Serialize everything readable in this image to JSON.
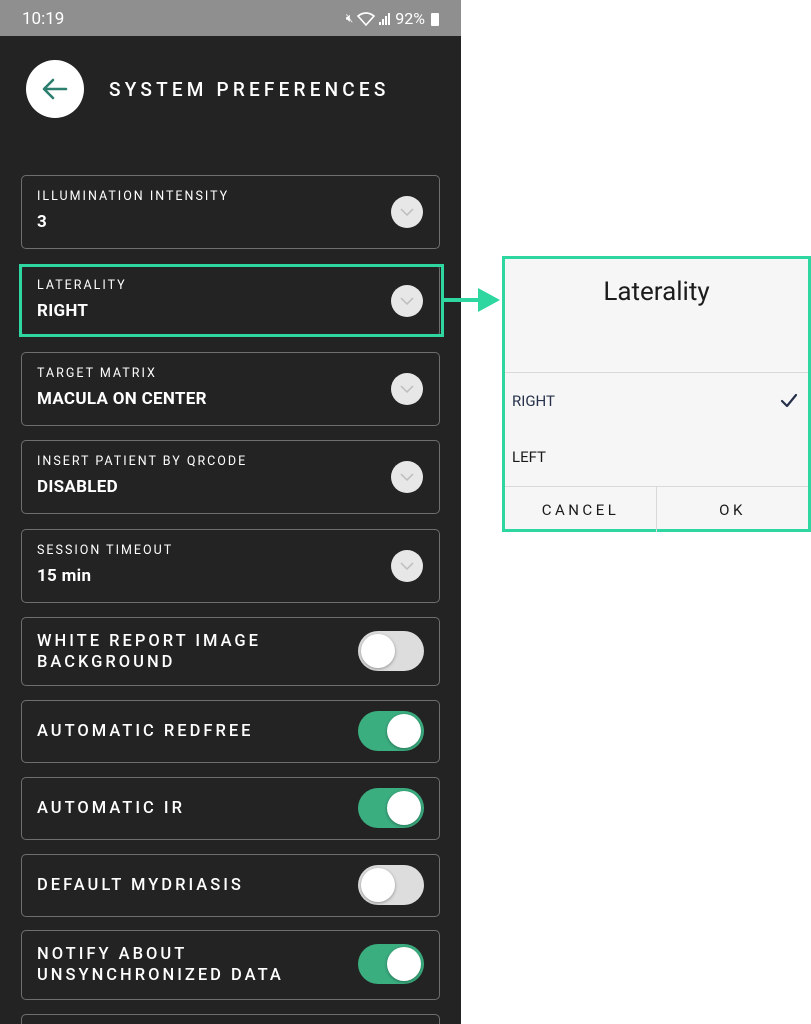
{
  "status_bar": {
    "time": "10:19",
    "battery": "92%"
  },
  "header": {
    "title": "SYSTEM PREFERENCES"
  },
  "dropdowns": [
    {
      "label": "ILLUMINATION INTENSITY",
      "value": "3"
    },
    {
      "label": "LATERALITY",
      "value": "RIGHT"
    },
    {
      "label": "TARGET MATRIX",
      "value": "MACULA ON CENTER"
    },
    {
      "label": "INSERT PATIENT BY QRCODE",
      "value": "DISABLED"
    },
    {
      "label": "SESSION TIMEOUT",
      "value": "15 min"
    }
  ],
  "toggles": [
    {
      "line1": "WHITE REPORT IMAGE",
      "line2": "BACKGROUND",
      "on": false
    },
    {
      "line1": "AUTOMATIC REDFREE",
      "on": true
    },
    {
      "line1": "AUTOMATIC IR",
      "on": true
    },
    {
      "line1": "DEFAULT MYDRIASIS",
      "on": false
    },
    {
      "line1": "NOTIFY ABOUT",
      "line2": "UNSYNCHRONIZED DATA",
      "on": true
    }
  ],
  "dialog": {
    "title": "Laterality",
    "options": [
      {
        "label": "RIGHT",
        "selected": true
      },
      {
        "label": "LEFT",
        "selected": false
      }
    ],
    "cancel": "CANCEL",
    "ok": "OK"
  },
  "colors": {
    "background": "#232323",
    "accent": "#2ed6a0",
    "toggle_on": "#3bae80",
    "toggle_off": "#dddddd"
  }
}
